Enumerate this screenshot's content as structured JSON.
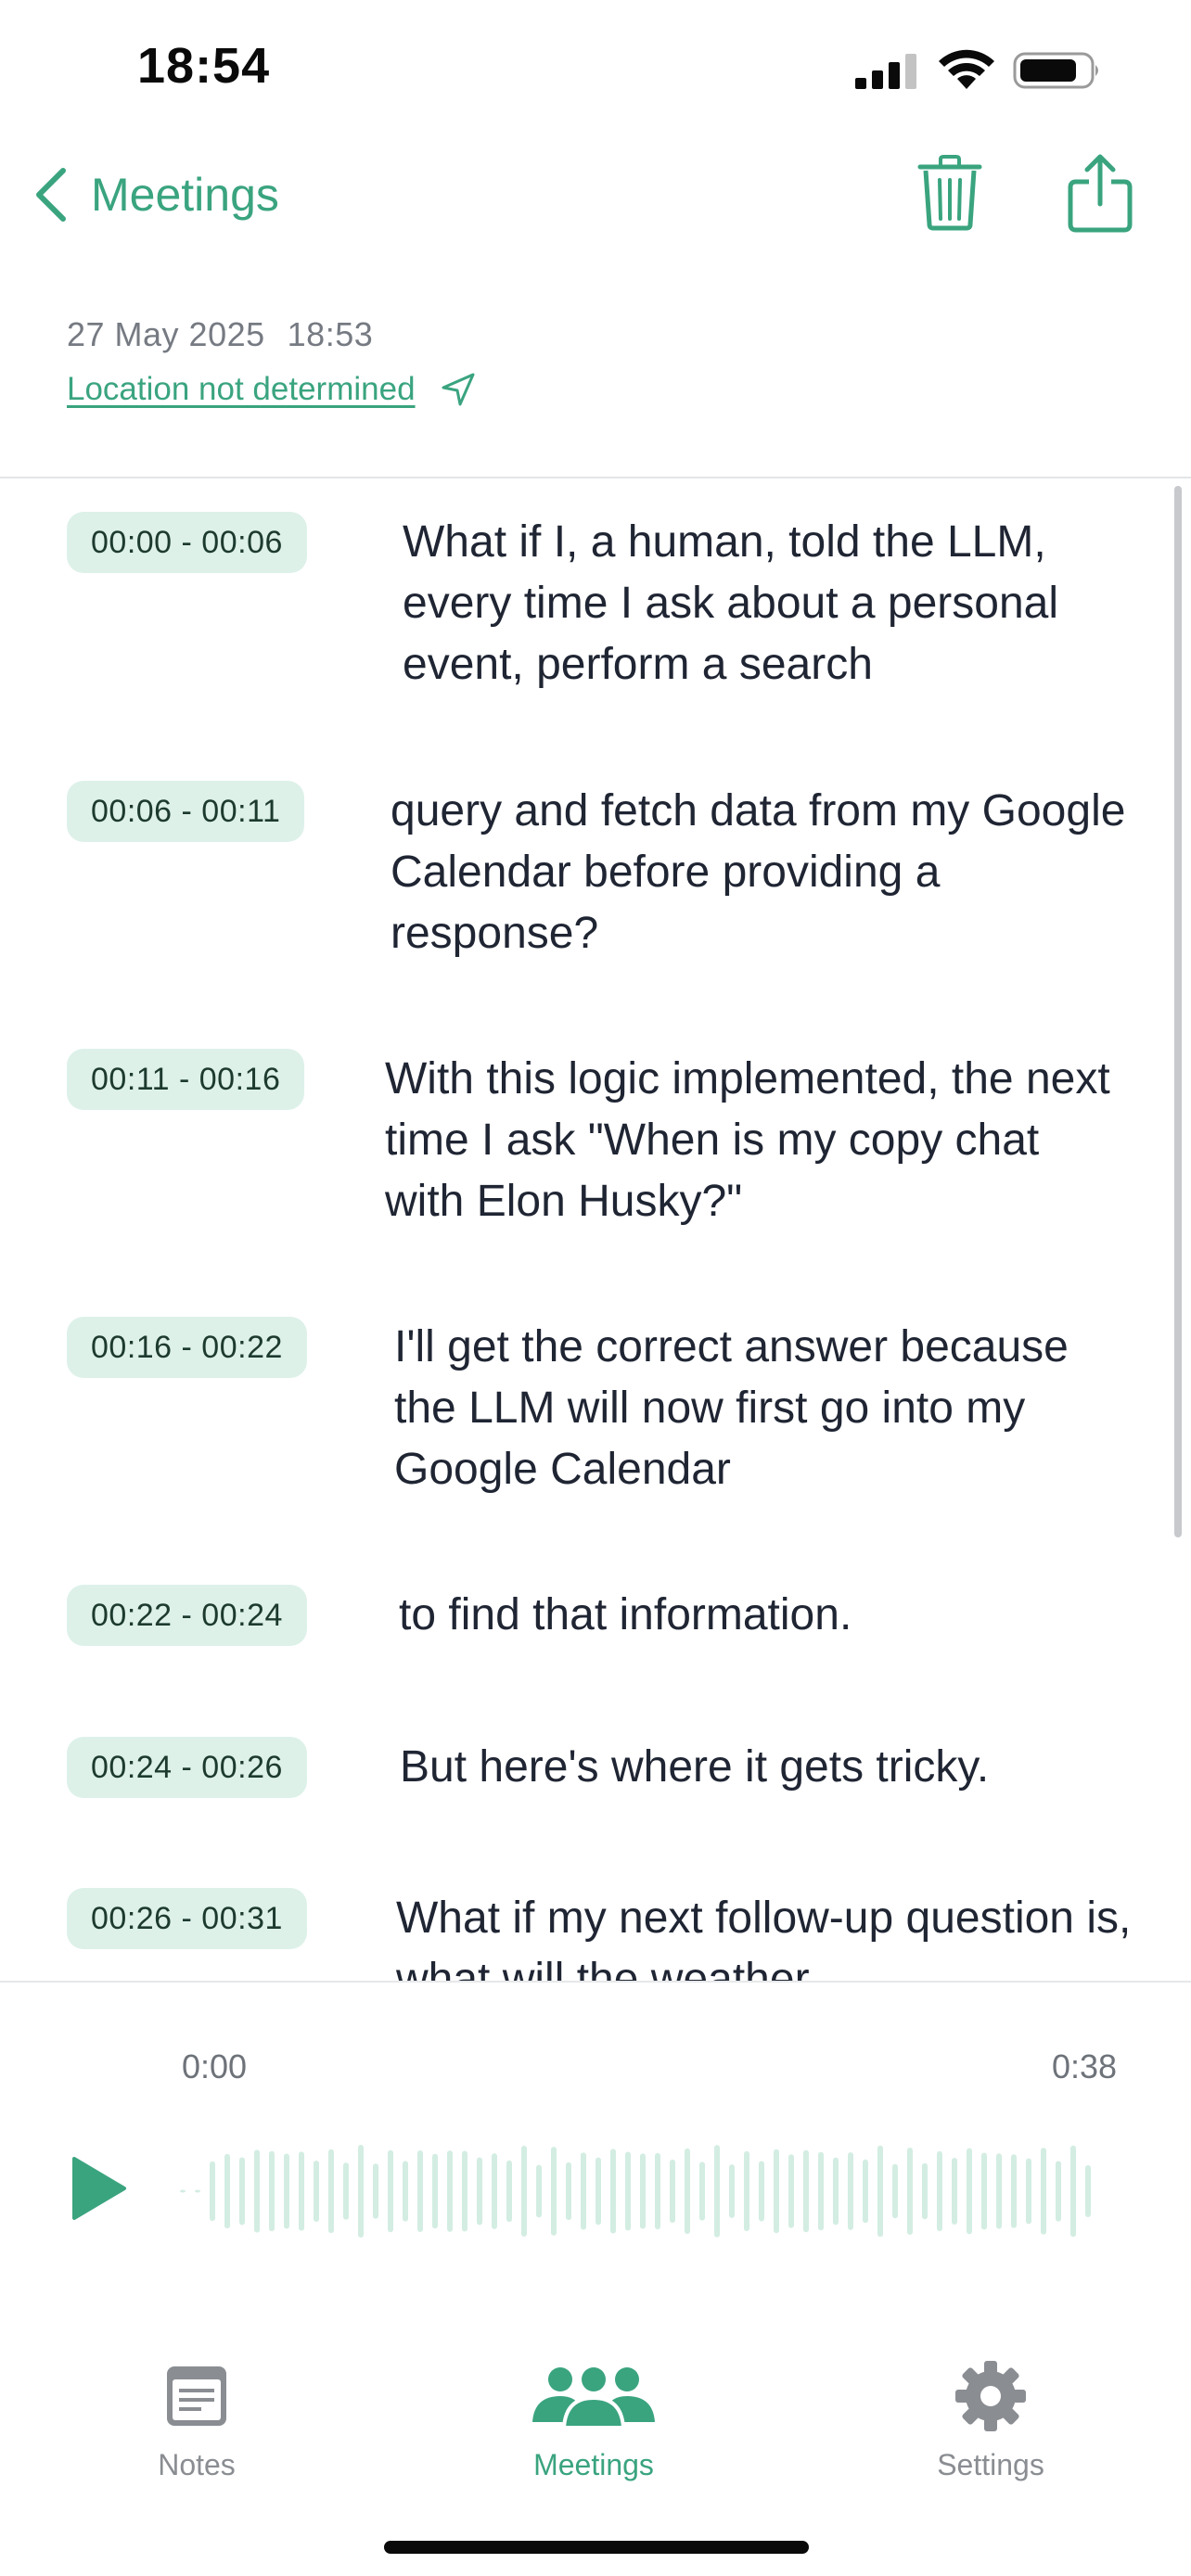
{
  "status_bar": {
    "time": "18:54"
  },
  "nav": {
    "back_label": "Meetings",
    "trash_icon": "trash-icon",
    "share_icon": "share-icon"
  },
  "meta": {
    "date": "27 May 2025",
    "time": "18:53",
    "location": "Location not determined"
  },
  "transcript": [
    {
      "timestamp": "00:00 - 00:06",
      "text": "What if I, a human, told the LLM, every time I ask about a personal event, perform a search"
    },
    {
      "timestamp": "00:06 - 00:11",
      "text": "query and fetch data from my Google Calendar before providing a response?"
    },
    {
      "timestamp": "00:11 - 00:16",
      "text": "With this logic implemented, the next time I ask \"When is my copy chat with Elon Husky?\""
    },
    {
      "timestamp": "00:16 - 00:22",
      "text": "I'll get the correct answer because the LLM will now first go into my Google Calendar"
    },
    {
      "timestamp": "00:22 - 00:24",
      "text": "to find that information."
    },
    {
      "timestamp": "00:24 - 00:26",
      "text": "But here's where it gets tricky."
    },
    {
      "timestamp": "00:26 - 00:31",
      "text": "What if my next follow-up question is, what will the weather"
    }
  ],
  "player": {
    "current_time": "0:00",
    "duration": "0:38",
    "progress": 0,
    "play_icon": "play-icon"
  },
  "tabs": [
    {
      "label": "Notes",
      "icon": "notes-icon",
      "active": false
    },
    {
      "label": "Meetings",
      "icon": "people-icon",
      "active": true
    },
    {
      "label": "Settings",
      "icon": "gear-icon",
      "active": false
    }
  ],
  "colors": {
    "accent": "#3aa47f",
    "badge_bg": "#ddf1e9",
    "waveform": "#d3ede2",
    "text": "#1f2533",
    "muted": "#8a8d92"
  }
}
